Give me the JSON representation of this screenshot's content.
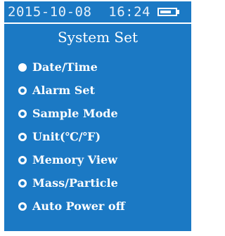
{
  "status_bar": {
    "datetime": "2015-10-08  16:24",
    "battery_icon": "battery-icon",
    "battery_level": 0.75
  },
  "title": "System Set",
  "menu": {
    "items": [
      {
        "label": "Date/Time",
        "selected": true
      },
      {
        "label": "Alarm Set",
        "selected": false
      },
      {
        "label": "Sample Mode",
        "selected": false
      },
      {
        "label": "Unit(℃/℉)",
        "selected": false
      },
      {
        "label": "Memory View",
        "selected": false
      },
      {
        "label": "Mass/Particle",
        "selected": false
      },
      {
        "label": "Auto Power off",
        "selected": false
      }
    ]
  },
  "colors": {
    "background": "#1b79c4",
    "text": "#ffffff",
    "datetime_text": "#e6f0fa"
  }
}
